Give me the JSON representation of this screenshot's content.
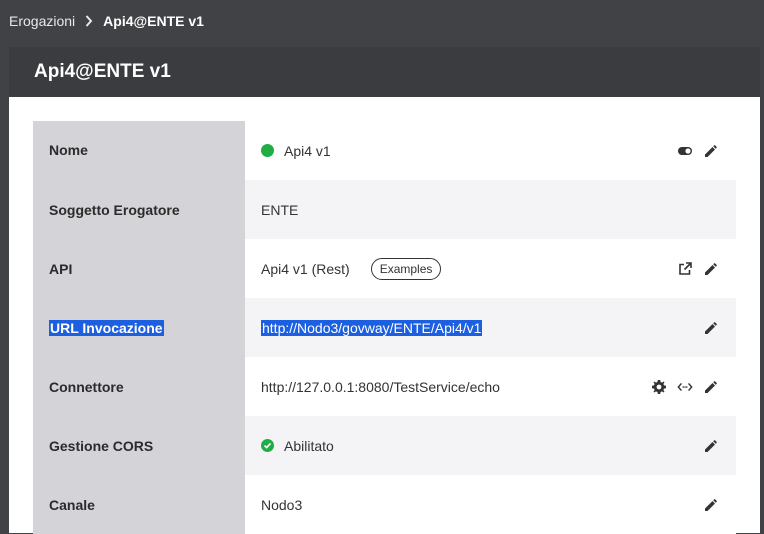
{
  "breadcrumb": {
    "parent": "Erogazioni",
    "current": "Api4@ENTE v1"
  },
  "header": {
    "title": "Api4@ENTE v1"
  },
  "rows": [
    {
      "label": "Nome",
      "value": "Api4 v1",
      "status": "green-dot",
      "actions": [
        "toggle-icon",
        "edit-icon"
      ]
    },
    {
      "label": "Soggetto Erogatore",
      "value": "ENTE",
      "actions": []
    },
    {
      "label": "API",
      "value": "Api4 v1 (Rest)",
      "badge": "Examples",
      "actions": [
        "external-link-icon",
        "edit-icon"
      ]
    },
    {
      "label": "URL Invocazione",
      "value": "http://Nodo3/govway/ENTE/Api4/v1",
      "selected": true,
      "actions": [
        "edit-icon"
      ]
    },
    {
      "label": "Connettore",
      "value": "http://127.0.0.1:8080/TestService/echo",
      "actions": [
        "gear-icon",
        "code-icon",
        "edit-icon"
      ]
    },
    {
      "label": "Gestione CORS",
      "value": "Abilitato",
      "status": "green-check",
      "actions": [
        "edit-icon"
      ]
    },
    {
      "label": "Canale",
      "value": "Nodo3",
      "actions": [
        "edit-icon"
      ]
    }
  ],
  "colors": {
    "background": "#414246",
    "header": "#3b3c40",
    "label_cell": "#d3d3d8",
    "status_green": "#1fae46",
    "selection": "#1c5fe0"
  }
}
